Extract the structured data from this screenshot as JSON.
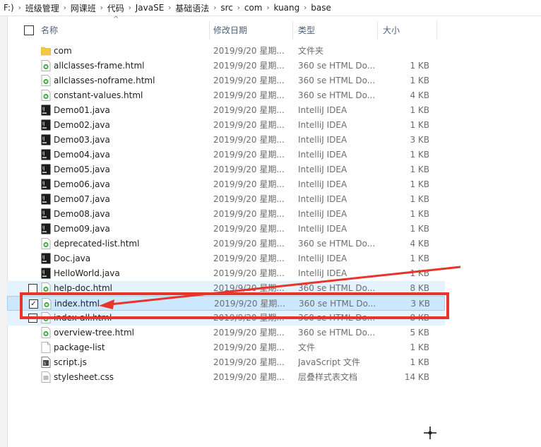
{
  "breadcrumb": [
    "F:)",
    "班级管理",
    "网课班",
    "代码",
    "JavaSE",
    "基础语法",
    "src",
    "com",
    "kuang",
    "base"
  ],
  "columns": {
    "name": "名称",
    "date": "修改日期",
    "type": "类型",
    "size": "大小"
  },
  "files": [
    {
      "name": "com",
      "date": "2019/9/20 星期...",
      "type": "文件夹",
      "size": "",
      "icon": "folder-icon"
    },
    {
      "name": "allclasses-frame.html",
      "date": "2019/9/20 星期...",
      "type": "360 se HTML Do...",
      "size": "1 KB",
      "icon": "html-file-icon"
    },
    {
      "name": "allclasses-noframe.html",
      "date": "2019/9/20 星期...",
      "type": "360 se HTML Do...",
      "size": "1 KB",
      "icon": "html-file-icon"
    },
    {
      "name": "constant-values.html",
      "date": "2019/9/20 星期...",
      "type": "360 se HTML Do...",
      "size": "4 KB",
      "icon": "html-file-icon"
    },
    {
      "name": "Demo01.java",
      "date": "2019/9/20 星期...",
      "type": "IntelliJ IDEA",
      "size": "1 KB",
      "icon": "java-file-icon"
    },
    {
      "name": "Demo02.java",
      "date": "2019/9/20 星期...",
      "type": "IntelliJ IDEA",
      "size": "1 KB",
      "icon": "java-file-icon"
    },
    {
      "name": "Demo03.java",
      "date": "2019/9/20 星期...",
      "type": "IntelliJ IDEA",
      "size": "3 KB",
      "icon": "java-file-icon"
    },
    {
      "name": "Demo04.java",
      "date": "2019/9/20 星期...",
      "type": "IntelliJ IDEA",
      "size": "1 KB",
      "icon": "java-file-icon"
    },
    {
      "name": "Demo05.java",
      "date": "2019/9/20 星期...",
      "type": "IntelliJ IDEA",
      "size": "1 KB",
      "icon": "java-file-icon"
    },
    {
      "name": "Demo06.java",
      "date": "2019/9/20 星期...",
      "type": "IntelliJ IDEA",
      "size": "1 KB",
      "icon": "java-file-icon"
    },
    {
      "name": "Demo07.java",
      "date": "2019/9/20 星期...",
      "type": "IntelliJ IDEA",
      "size": "1 KB",
      "icon": "java-file-icon"
    },
    {
      "name": "Demo08.java",
      "date": "2019/9/20 星期...",
      "type": "IntelliJ IDEA",
      "size": "1 KB",
      "icon": "java-file-icon"
    },
    {
      "name": "Demo09.java",
      "date": "2019/9/20 星期...",
      "type": "IntelliJ IDEA",
      "size": "1 KB",
      "icon": "java-file-icon"
    },
    {
      "name": "deprecated-list.html",
      "date": "2019/9/20 星期...",
      "type": "360 se HTML Do...",
      "size": "4 KB",
      "icon": "html-file-icon"
    },
    {
      "name": "Doc.java",
      "date": "2019/9/20 星期...",
      "type": "IntelliJ IDEA",
      "size": "1 KB",
      "icon": "java-file-icon"
    },
    {
      "name": "HelloWorld.java",
      "date": "2019/9/20 星期...",
      "type": "IntelliJ IDEA",
      "size": "1 KB",
      "icon": "java-file-icon"
    },
    {
      "name": "help-doc.html",
      "date": "2019/9/20 星期...",
      "type": "360 se HTML Do...",
      "size": "8 KB",
      "icon": "html-file-icon",
      "state": "dimmed"
    },
    {
      "name": "index.html",
      "date": "2019/9/20 星期...",
      "type": "360 se HTML Do...",
      "size": "3 KB",
      "icon": "html-file-icon",
      "state": "selected"
    },
    {
      "name": "index-all.html",
      "date": "2019/9/20 星期...",
      "type": "360 se HTML Do...",
      "size": "8 KB",
      "icon": "html-file-icon",
      "state": "dimmed"
    },
    {
      "name": "overview-tree.html",
      "date": "2019/9/20 星期...",
      "type": "360 se HTML Do...",
      "size": "5 KB",
      "icon": "html-file-icon"
    },
    {
      "name": "package-list",
      "date": "2019/9/20 星期...",
      "type": "文件",
      "size": "1 KB",
      "icon": "blank-file-icon"
    },
    {
      "name": "script.js",
      "date": "2019/9/20 星期...",
      "type": "JavaScript 文件",
      "size": "1 KB",
      "icon": "js-file-icon"
    },
    {
      "name": "stylesheet.css",
      "date": "2019/9/20 星期...",
      "type": "层叠样式表文档",
      "size": "14 KB",
      "icon": "css-file-icon"
    }
  ],
  "colors": {
    "selection": "#cce8ff",
    "highlight_box": "#e8352b",
    "header_text": "#4c607a"
  }
}
